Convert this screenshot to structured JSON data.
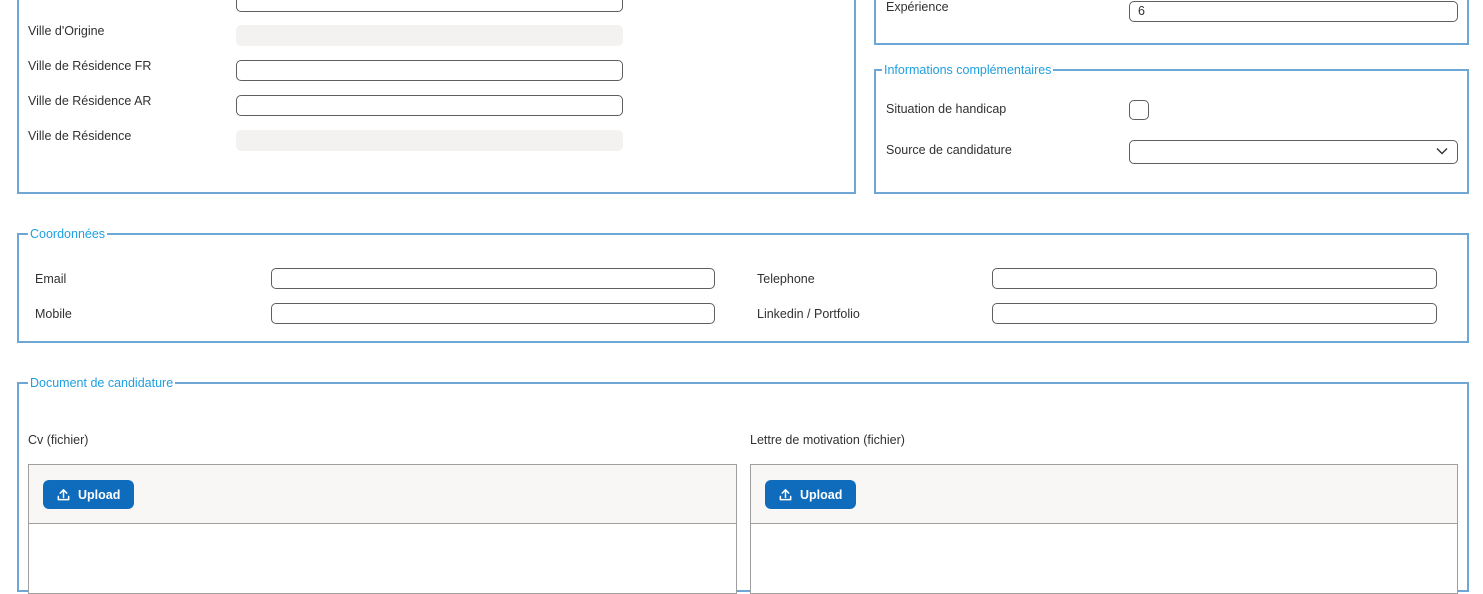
{
  "identity": {
    "ville_origine_label": "Ville d'Origine",
    "ville_residence_fr_label": "Ville de Résidence FR",
    "ville_residence_ar_label": "Ville de Résidence AR",
    "ville_residence_label": "Ville de Résidence"
  },
  "experience": {
    "label": "Expérience",
    "value": "6"
  },
  "infos": {
    "legend": "Informations complémentaires",
    "handicap_label": "Situation de handicap",
    "source_label": "Source de candidature",
    "source_value": ""
  },
  "coordonnees": {
    "legend": "Coordonnées",
    "email_label": "Email",
    "mobile_label": "Mobile",
    "telephone_label": "Telephone",
    "linkedin_label": "Linkedin / Portfolio"
  },
  "documents": {
    "legend": "Document de candidature",
    "cv_label": "Cv (fichier)",
    "lettre_label": "Lettre de motivation (fichier)",
    "upload_label": "Upload"
  },
  "icons": {
    "upload": "upload-icon",
    "dropdown": "chevron-down-icon"
  },
  "colors": {
    "fieldset_border": "#6ea6d6",
    "legend_text": "#1e9fe0",
    "primary_button": "#0f6cbd",
    "readonly_field": "#f3f2f1"
  }
}
